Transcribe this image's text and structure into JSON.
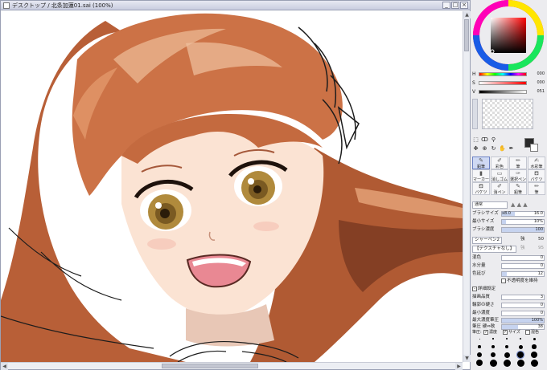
{
  "titlebar": {
    "title": "デスクトップ / 北条加蓮01.sai (100%)",
    "minimize": "_",
    "maximize": "□",
    "close": "×"
  },
  "colors": {
    "hair_main": "#c46a3f",
    "hair_light": "#e49a6e",
    "hair_dark": "#7d3b22",
    "skin": "#fbe3d3",
    "iris": "#b08a3c",
    "mouth": "#e98893",
    "accent": "#6d83c4"
  },
  "color_panel": {
    "h_label": "H",
    "h_value": "000",
    "s_label": "S",
    "s_value": "000",
    "v_label": "V",
    "v_value": "051"
  },
  "tools": [
    "select-rect-icon",
    "lasso-icon",
    "magic-wand-icon",
    "move-icon",
    "zoom-icon",
    "rotate-icon",
    "hand-icon",
    "eyedropper-icon"
  ],
  "brushes": [
    {
      "label": "鉛筆",
      "selected": true
    },
    {
      "label": "彩色",
      "selected": false
    },
    {
      "label": "筆",
      "selected": false
    },
    {
      "label": "水彩筆",
      "selected": false
    },
    {
      "label": "マーカー",
      "selected": false
    },
    {
      "label": "消しゴム",
      "selected": false
    },
    {
      "label": "選択ペン",
      "selected": false
    },
    {
      "label": "バケツ",
      "selected": false
    },
    {
      "label": "バケツ",
      "selected": false
    },
    {
      "label": "消ペン",
      "selected": false
    },
    {
      "label": "鉛筆",
      "selected": false
    },
    {
      "label": "筆",
      "selected": false
    }
  ],
  "blend_mode": "通常",
  "brush_params": {
    "size_label": "ブラシサイズ",
    "size_mult": "x8.0",
    "size_value": "16.0",
    "min_size_label": "最小サイズ",
    "min_size_value": "10%",
    "density_label": "ブラシ濃度",
    "density_value": "100",
    "shape_label": "シャーペン2",
    "shape_strength_label": "強",
    "shape_strength": "50",
    "texture_label": "【テクスチャなし】",
    "texture_strength_label": "強",
    "texture_strength": "95",
    "blend_label": "混色",
    "blend_value": "0",
    "water_label": "水分量",
    "water_value": "0",
    "persist_label": "色延び",
    "persist_value": "12",
    "keep_opacity_label": "不透明度を維持",
    "detail_label": "詳細設定",
    "quality_label": "描画品質",
    "quality_value": "3",
    "edge_label": "輪郭の硬さ",
    "edge_value": "0",
    "min_density_label": "最小濃度",
    "min_density_value": "0",
    "max_pressure_label": "最大濃度筆圧",
    "max_pressure_value": "100%",
    "pressure_hard_label": "筆圧 硬⇔軟",
    "pressure_hard_value": "38",
    "pressure_label": "筆圧:",
    "pressure_density": "濃度",
    "pressure_size": "サイズ",
    "pressure_blend": "混色"
  },
  "dot_sizes": [
    "1",
    "1.5",
    "2",
    "2.3",
    "2.6",
    "3",
    "3.5",
    "4",
    "5",
    "6",
    "7",
    "8",
    "9",
    "10",
    "12",
    "14",
    "16",
    "20",
    "25",
    "30"
  ]
}
